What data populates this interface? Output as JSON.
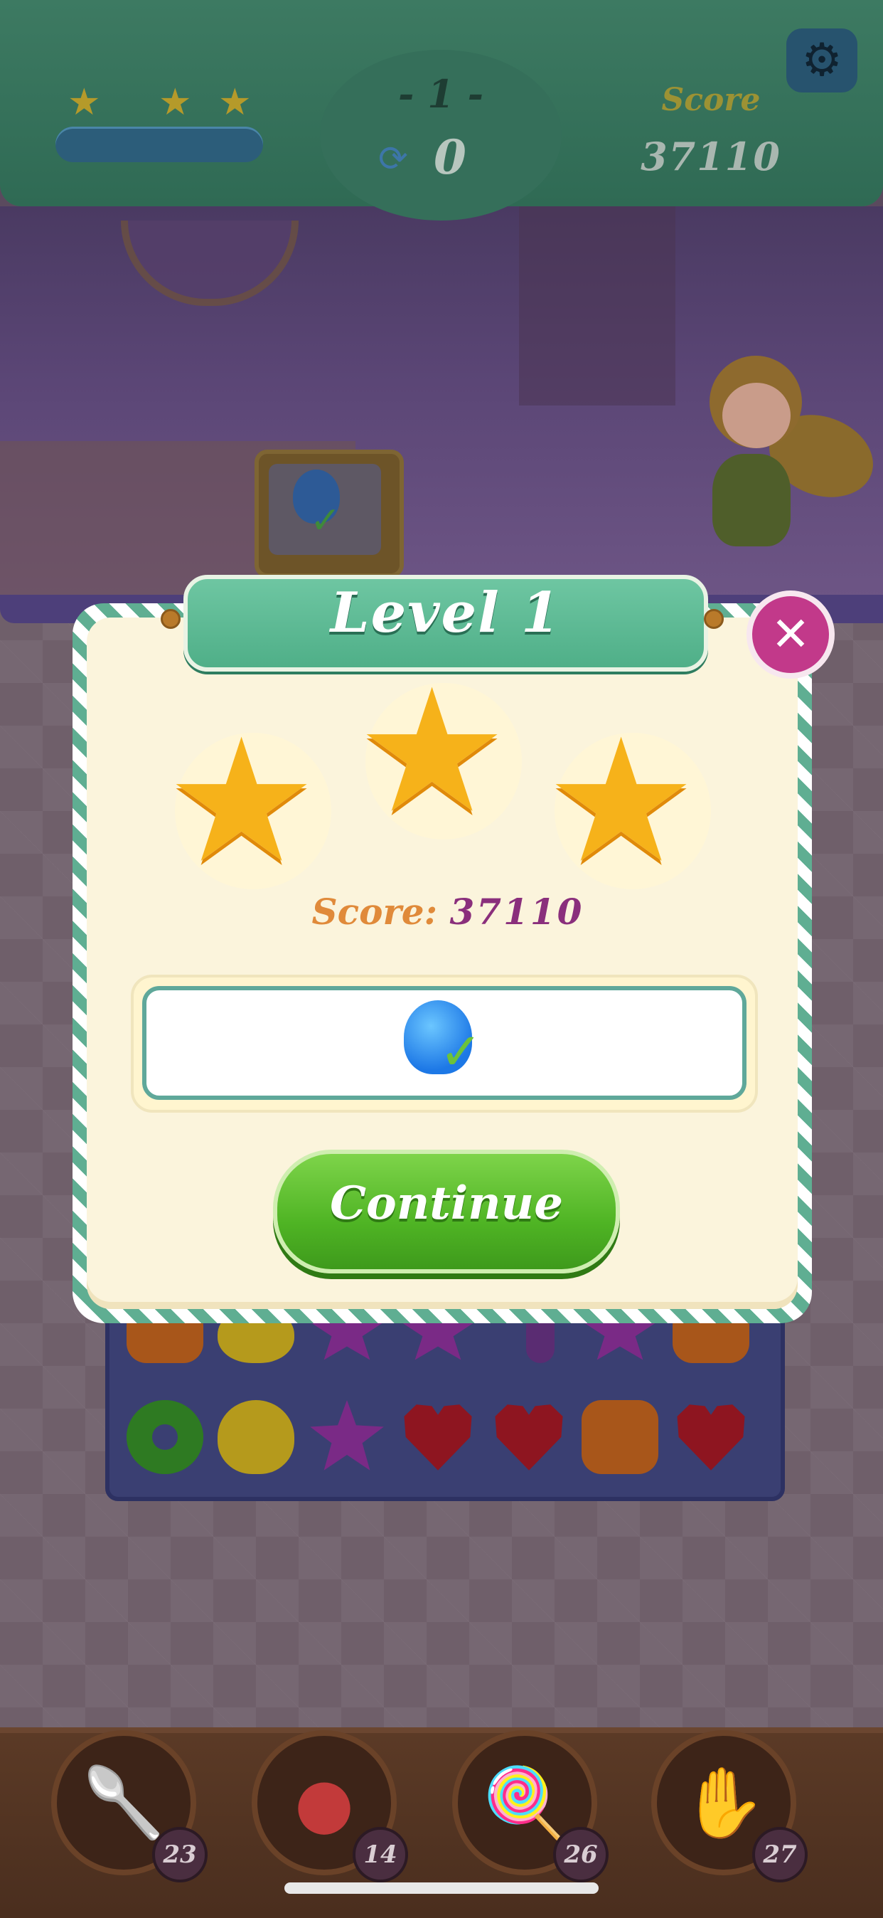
{
  "hud": {
    "level_label": "- 1 -",
    "moves": "0",
    "score_label": "Score",
    "score_value": "37110",
    "stars_filled": 3,
    "progress_fill": 1.0
  },
  "dialog": {
    "title": "Level  1",
    "stars_earned": 3,
    "score_label": "Score:",
    "score_value": "37110",
    "continue_label": "Continue",
    "close_icon": "close-icon"
  },
  "boosters": [
    {
      "name": "spoon-booster",
      "count": "23"
    },
    {
      "name": "bomb-booster",
      "count": "14"
    },
    {
      "name": "lollipop-booster",
      "count": "26"
    },
    {
      "name": "glove-booster",
      "count": "27"
    }
  ],
  "colors": {
    "hud_green": "#3d7a62",
    "banner_green": "#4faf88",
    "continue_green": "#4fb424",
    "close_pink": "#c2398a",
    "star_gold": "#f6b21a",
    "score_purple": "#8a2f7c",
    "score_orange": "#e08a3a"
  }
}
